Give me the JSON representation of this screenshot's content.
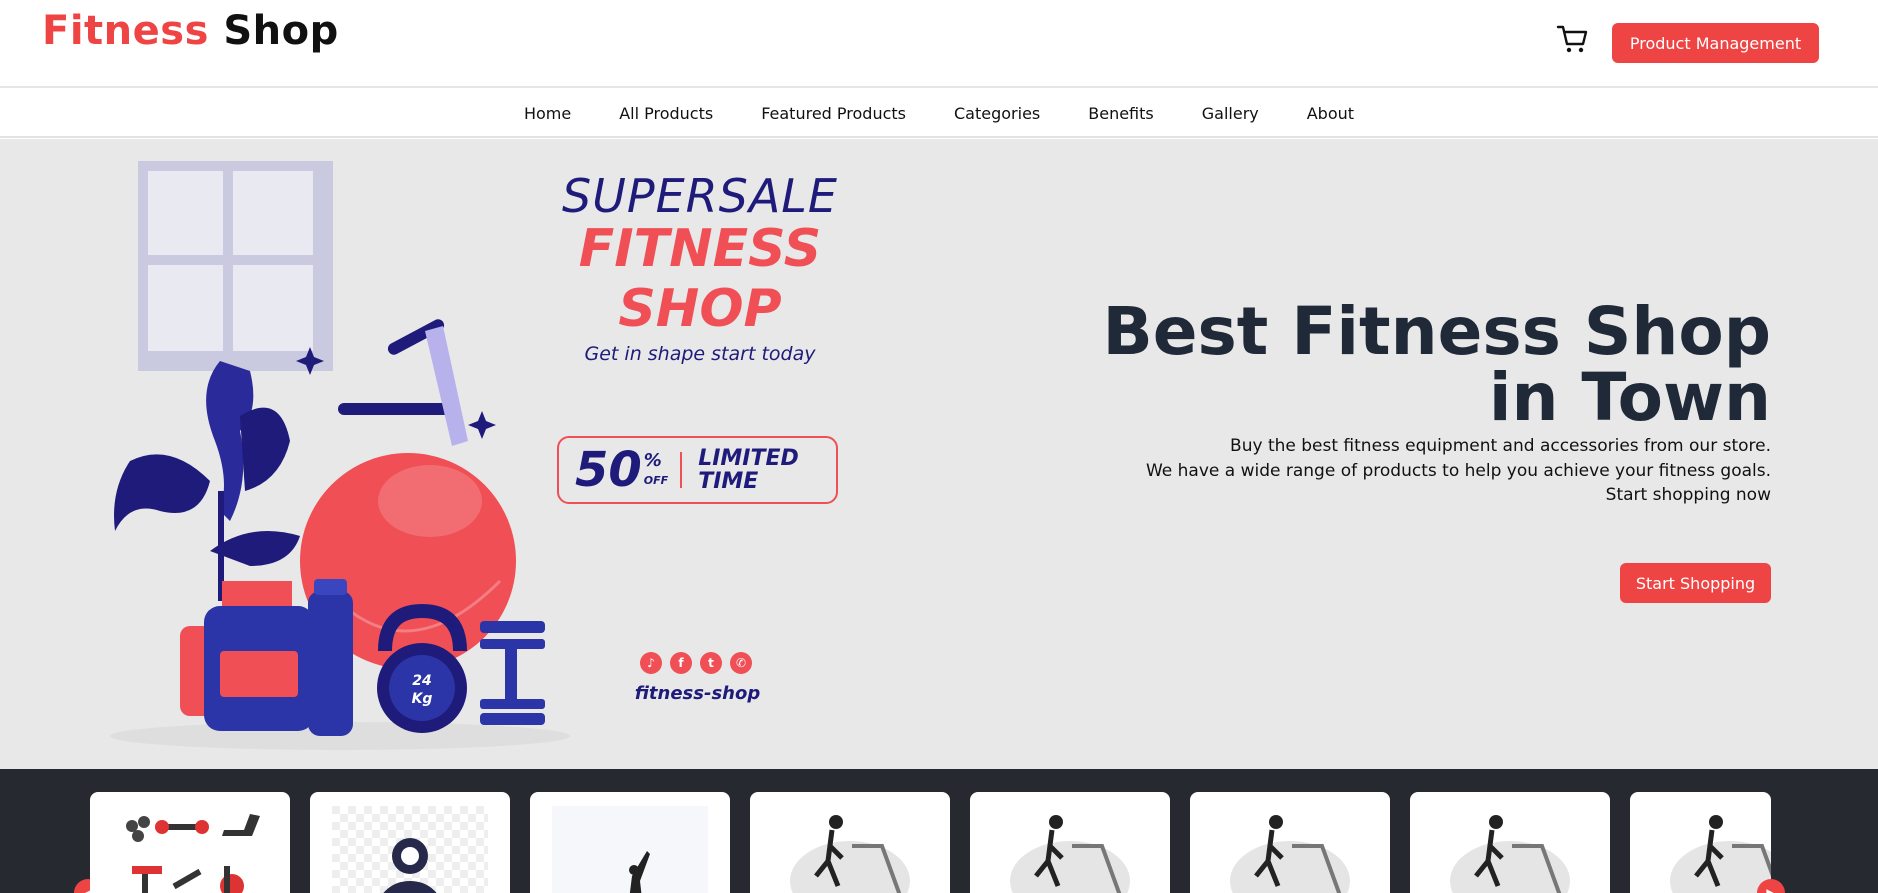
{
  "brand": {
    "word1": "Fitness",
    "word2": "Shop"
  },
  "header": {
    "product_management_label": "Product Management"
  },
  "nav": {
    "items": [
      "Home",
      "All Products",
      "Featured Products",
      "Categories",
      "Benefits",
      "Gallery",
      "About"
    ]
  },
  "promo": {
    "supersale": "SUPERSALE",
    "title": "FITNESS SHOP",
    "tagline": "Get in shape start today",
    "discount": "50",
    "percent": "%",
    "off": "OFF",
    "limited": "LIMITED",
    "time": "TIME",
    "weight": "24",
    "weight_unit": "Kg",
    "handle": "fitness-shop"
  },
  "hero": {
    "title_line1": "Best Fitness Shop",
    "title_line2": "in Town",
    "text_line1": "Buy the best fitness equipment and accessories from our store.",
    "text_line2": "We have a wide range of products to help you achieve your fitness goals.",
    "text_line3": "Start shopping now",
    "cta_label": "Start Shopping"
  },
  "colors": {
    "accent": "#ef4444",
    "navy": "#1e1b7b",
    "hero_bg": "#e8e8e8",
    "strip_bg": "#26292f"
  },
  "carousel": {
    "cards": [
      {
        "name": "equipment-set"
      },
      {
        "name": "logo-placeholder"
      },
      {
        "name": "silhouette"
      },
      {
        "name": "treadmill-runner"
      },
      {
        "name": "treadmill-runner"
      },
      {
        "name": "treadmill-runner"
      },
      {
        "name": "treadmill-runner"
      },
      {
        "name": "treadmill-runner"
      }
    ]
  }
}
